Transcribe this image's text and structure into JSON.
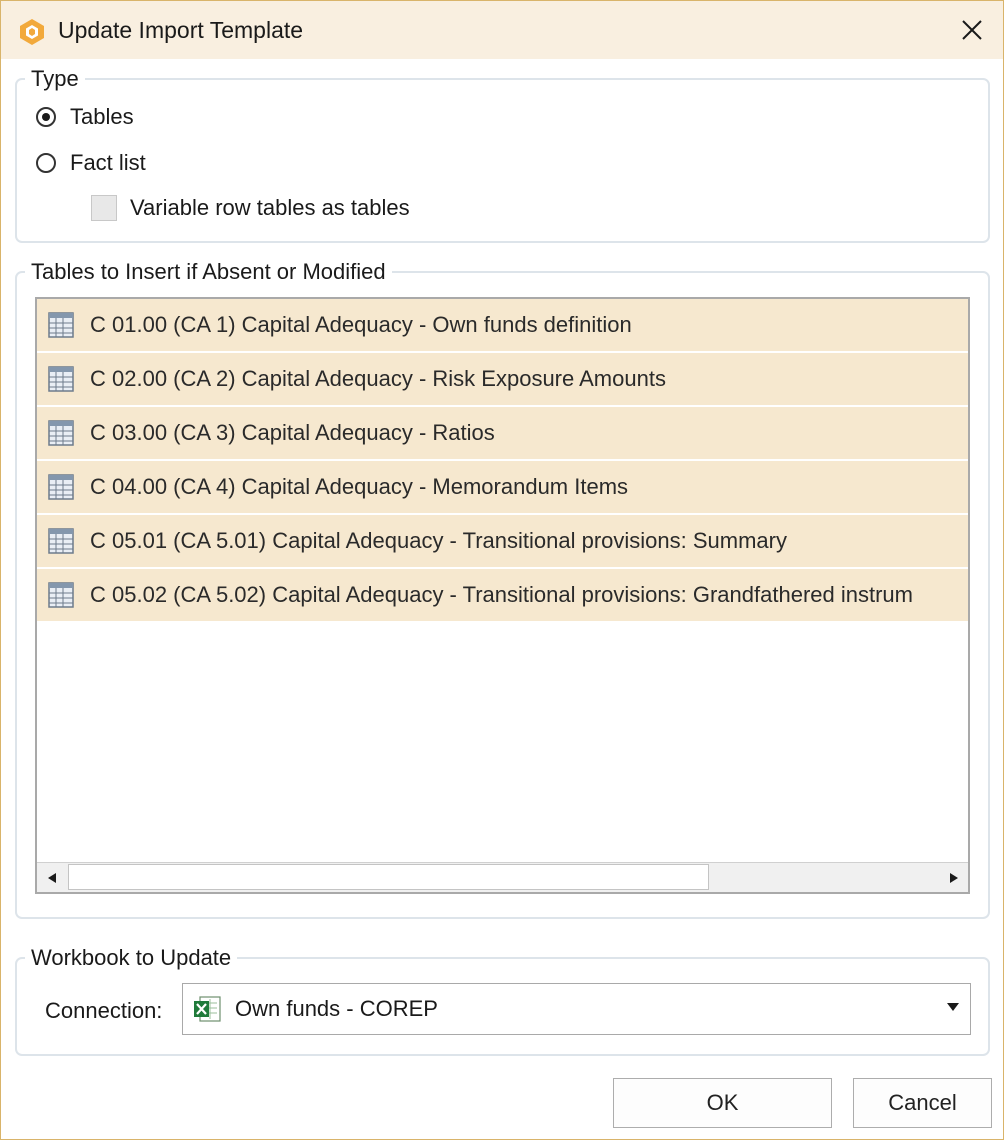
{
  "window": {
    "title": "Update Import Template"
  },
  "type_group": {
    "legend": "Type",
    "options": [
      {
        "label": "Tables",
        "selected": true
      },
      {
        "label": "Fact list",
        "selected": false
      }
    ],
    "checkbox": {
      "label": "Variable row tables as tables",
      "checked": false
    }
  },
  "tables_group": {
    "legend": "Tables to Insert if Absent or Modified",
    "items": [
      {
        "label": "C 01.00 (CA 1) Capital Adequacy - Own funds definition",
        "icon": "table-grid-icon"
      },
      {
        "label": "C 02.00 (CA 2) Capital Adequacy - Risk Exposure Amounts",
        "icon": "table-grid-icon"
      },
      {
        "label": "C 03.00 (CA 3) Capital Adequacy - Ratios",
        "icon": "table-grid-icon"
      },
      {
        "label": "C 04.00 (CA 4) Capital Adequacy - Memorandum Items",
        "icon": "table-grid-icon"
      },
      {
        "label": "C 05.01 (CA 5.01) Capital Adequacy - Transitional provisions: Summary",
        "icon": "table-grid-icon"
      },
      {
        "label": "C 05.02 (CA 5.02) Capital Adequacy - Transitional provisions: Grandfathered instrum",
        "icon": "table-grid-icon"
      }
    ]
  },
  "workbook_group": {
    "legend": "Workbook to Update",
    "connection_label": "Connection:",
    "connection_value": "Own funds - COREP",
    "connection_icon": "excel-workbook-icon"
  },
  "buttons": {
    "ok": "OK",
    "cancel": "Cancel"
  },
  "colors": {
    "accent": "#f2a93b",
    "titlebar": "#f9efe0",
    "row_highlight": "#f6e8cf",
    "window_border": "#d9b46a"
  }
}
